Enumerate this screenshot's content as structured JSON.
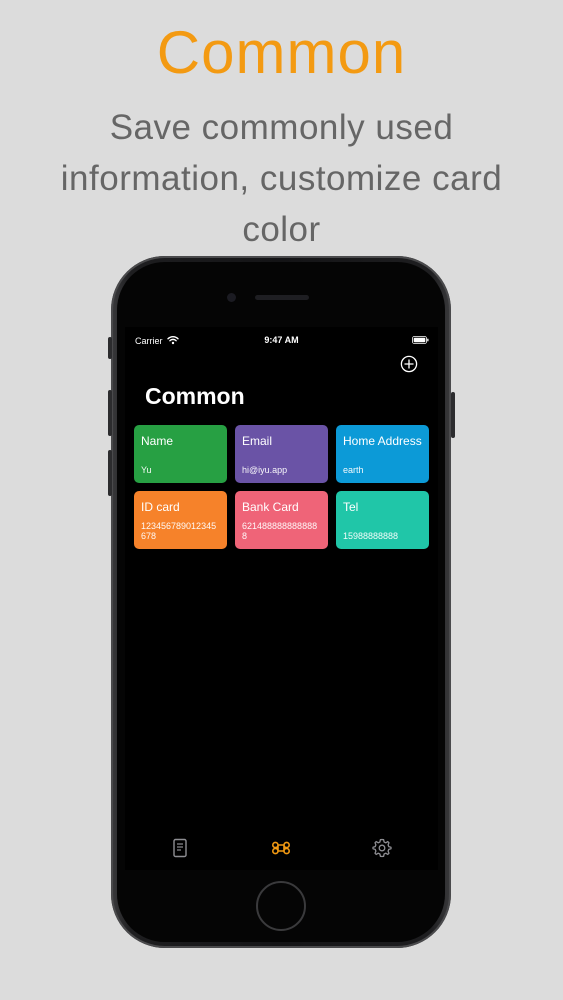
{
  "promo": {
    "headline": "Common",
    "subtitle": "Save commonly used information, customize card color"
  },
  "status_bar": {
    "carrier": "Carrier",
    "time": "9:47 AM",
    "icons": [
      "wifi-icon",
      "battery-icon"
    ]
  },
  "nav": {
    "title": "Common",
    "add_icon": "plus-circle-icon"
  },
  "cards": [
    {
      "title": "Name",
      "value": "Yu",
      "color": "#27a043"
    },
    {
      "title": "Email",
      "value": "hi@iyu.app",
      "color": "#6a53a6"
    },
    {
      "title": "Home Address",
      "value": "earth",
      "color": "#0c9ad7"
    },
    {
      "title": "ID card",
      "value": "123456789012345678",
      "color": "#f6822a"
    },
    {
      "title": "Bank Card",
      "value": "6214888888888888",
      "color": "#ef6478"
    },
    {
      "title": "Tel",
      "value": "15988888888",
      "color": "#20c6a8"
    }
  ],
  "tab_bar": {
    "items": [
      {
        "icon": "document-icon",
        "color": "#8e8e93"
      },
      {
        "icon": "command-icon",
        "color": "#f39a12",
        "selected": true
      },
      {
        "icon": "gear-icon",
        "color": "#8e8e93"
      }
    ]
  },
  "colors": {
    "accent": "#f39a12",
    "background": "#dcdcdc",
    "subtitle": "#666666"
  }
}
